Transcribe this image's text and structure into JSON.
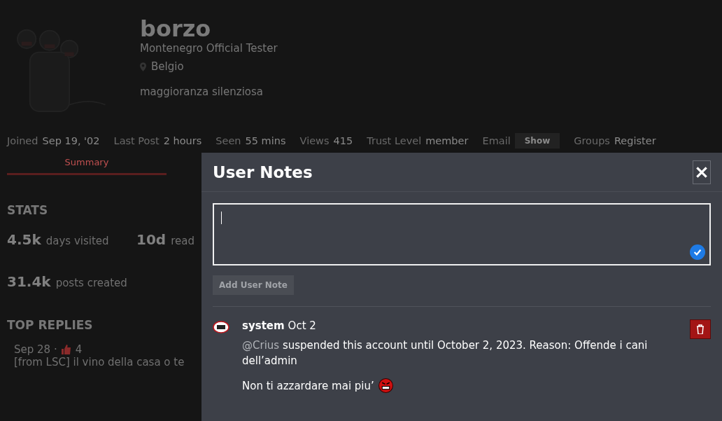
{
  "profile": {
    "username": "borzo",
    "title": "Montenegro Official Tester",
    "location": "Belgio",
    "bio": "maggioranza silenziosa"
  },
  "meta": [
    {
      "kind": "text",
      "label": "Joined",
      "value": "Sep 19, '02"
    },
    {
      "kind": "text",
      "label": "Last Post",
      "value": "2 hours"
    },
    {
      "kind": "text",
      "label": "Seen",
      "value": "55 mins"
    },
    {
      "kind": "text",
      "label": "Views",
      "value": "415"
    },
    {
      "kind": "text",
      "label": "Trust Level",
      "value": "member"
    },
    {
      "kind": "button",
      "label": "Email",
      "value": "Show"
    },
    {
      "kind": "text",
      "label": "Groups",
      "value": "Register"
    }
  ],
  "tabs": [
    {
      "label": "Summary",
      "selected": true
    }
  ],
  "stats": {
    "title": "STATS",
    "items": [
      {
        "value": "4.5k",
        "label": "days visited"
      },
      {
        "value": "10d",
        "label": "read"
      },
      {
        "value": "31.4k",
        "label": "posts created"
      }
    ]
  },
  "top_replies": {
    "title": "TOP REPLIES",
    "items": [
      {
        "date": "Sep 28 ·",
        "likes": "4",
        "text": "[from LSC] il vino della casa o te"
      }
    ]
  },
  "modal": {
    "title": "User Notes",
    "add_button": {
      "label": "Add User Note",
      "disabled": true
    },
    "notes": [
      {
        "author": "system",
        "date": "Oct 2",
        "mention": "@Crius",
        "text": "suspended this account until October 2, 2023. Reason: Offende i cani dell’admin",
        "comment": "Non ti azzardare mai piu’"
      }
    ]
  }
}
